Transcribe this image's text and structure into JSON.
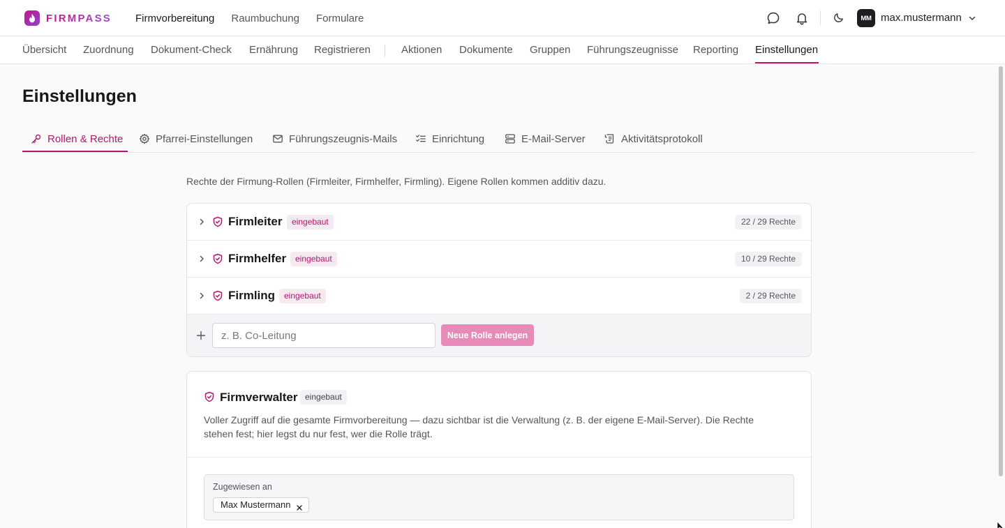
{
  "brand": {
    "name": "FIRMPASS"
  },
  "main_nav": [
    "Firmvorbereitung",
    "Raumbuchung",
    "Formulare"
  ],
  "user": {
    "initials": "MM",
    "name": "max.mustermann"
  },
  "sub_nav": {
    "group1": [
      "Übersicht",
      "Zuordnung",
      "Dokument-Check",
      "Ernährung",
      "Registrieren"
    ],
    "group2": [
      "Aktionen",
      "Dokumente",
      "Gruppen",
      "Führungszeugnisse",
      "Reporting",
      "Einstellungen"
    ],
    "active": "Einstellungen"
  },
  "page": {
    "title": "Einstellungen"
  },
  "settings_tabs": [
    {
      "label": "Rollen & Rechte",
      "icon": "key-icon",
      "active": true
    },
    {
      "label": "Pfarrei-Einstellungen",
      "icon": "gear-icon"
    },
    {
      "label": "Führungszeugnis-Mails",
      "icon": "mail-icon"
    },
    {
      "label": "Einrichtung",
      "icon": "checklist-icon"
    },
    {
      "label": "E-Mail-Server",
      "icon": "server-icon"
    },
    {
      "label": "Aktivitätsprotokoll",
      "icon": "log-icon"
    }
  ],
  "intro": "Rechte der Firmung-Rollen (Firmleiter, Firmhelfer, Firmling). Eigene Rollen kommen additiv dazu.",
  "roles": [
    {
      "name": "Firmleiter",
      "badge": "eingebaut",
      "rights": "22 / 29 Rechte"
    },
    {
      "name": "Firmhelfer",
      "badge": "eingebaut",
      "rights": "10 / 29 Rechte"
    },
    {
      "name": "Firmling",
      "badge": "eingebaut",
      "rights": "2 / 29 Rechte"
    }
  ],
  "new_role": {
    "placeholder": "z. B. Co-Leitung",
    "value": "",
    "button": "Neue Rolle anlegen"
  },
  "admin": {
    "title": "Firmverwalter",
    "badge": "eingebaut",
    "description": "Voller Zugriff auf die gesamte Firmvorbereitung — dazu sichtbar ist die Verwaltung (z. B. der eigene E-Mail-Server). Die Rechte stehen fest; hier legst du nur fest, wer die Rolle trägt.",
    "assigned_label": "Zugewiesen an",
    "assigned": [
      "Max Mustermann"
    ]
  },
  "colors": {
    "accent": "#b5166f",
    "button_disabled": "#e68ab7",
    "badge_bg": "#f6eaf1"
  }
}
